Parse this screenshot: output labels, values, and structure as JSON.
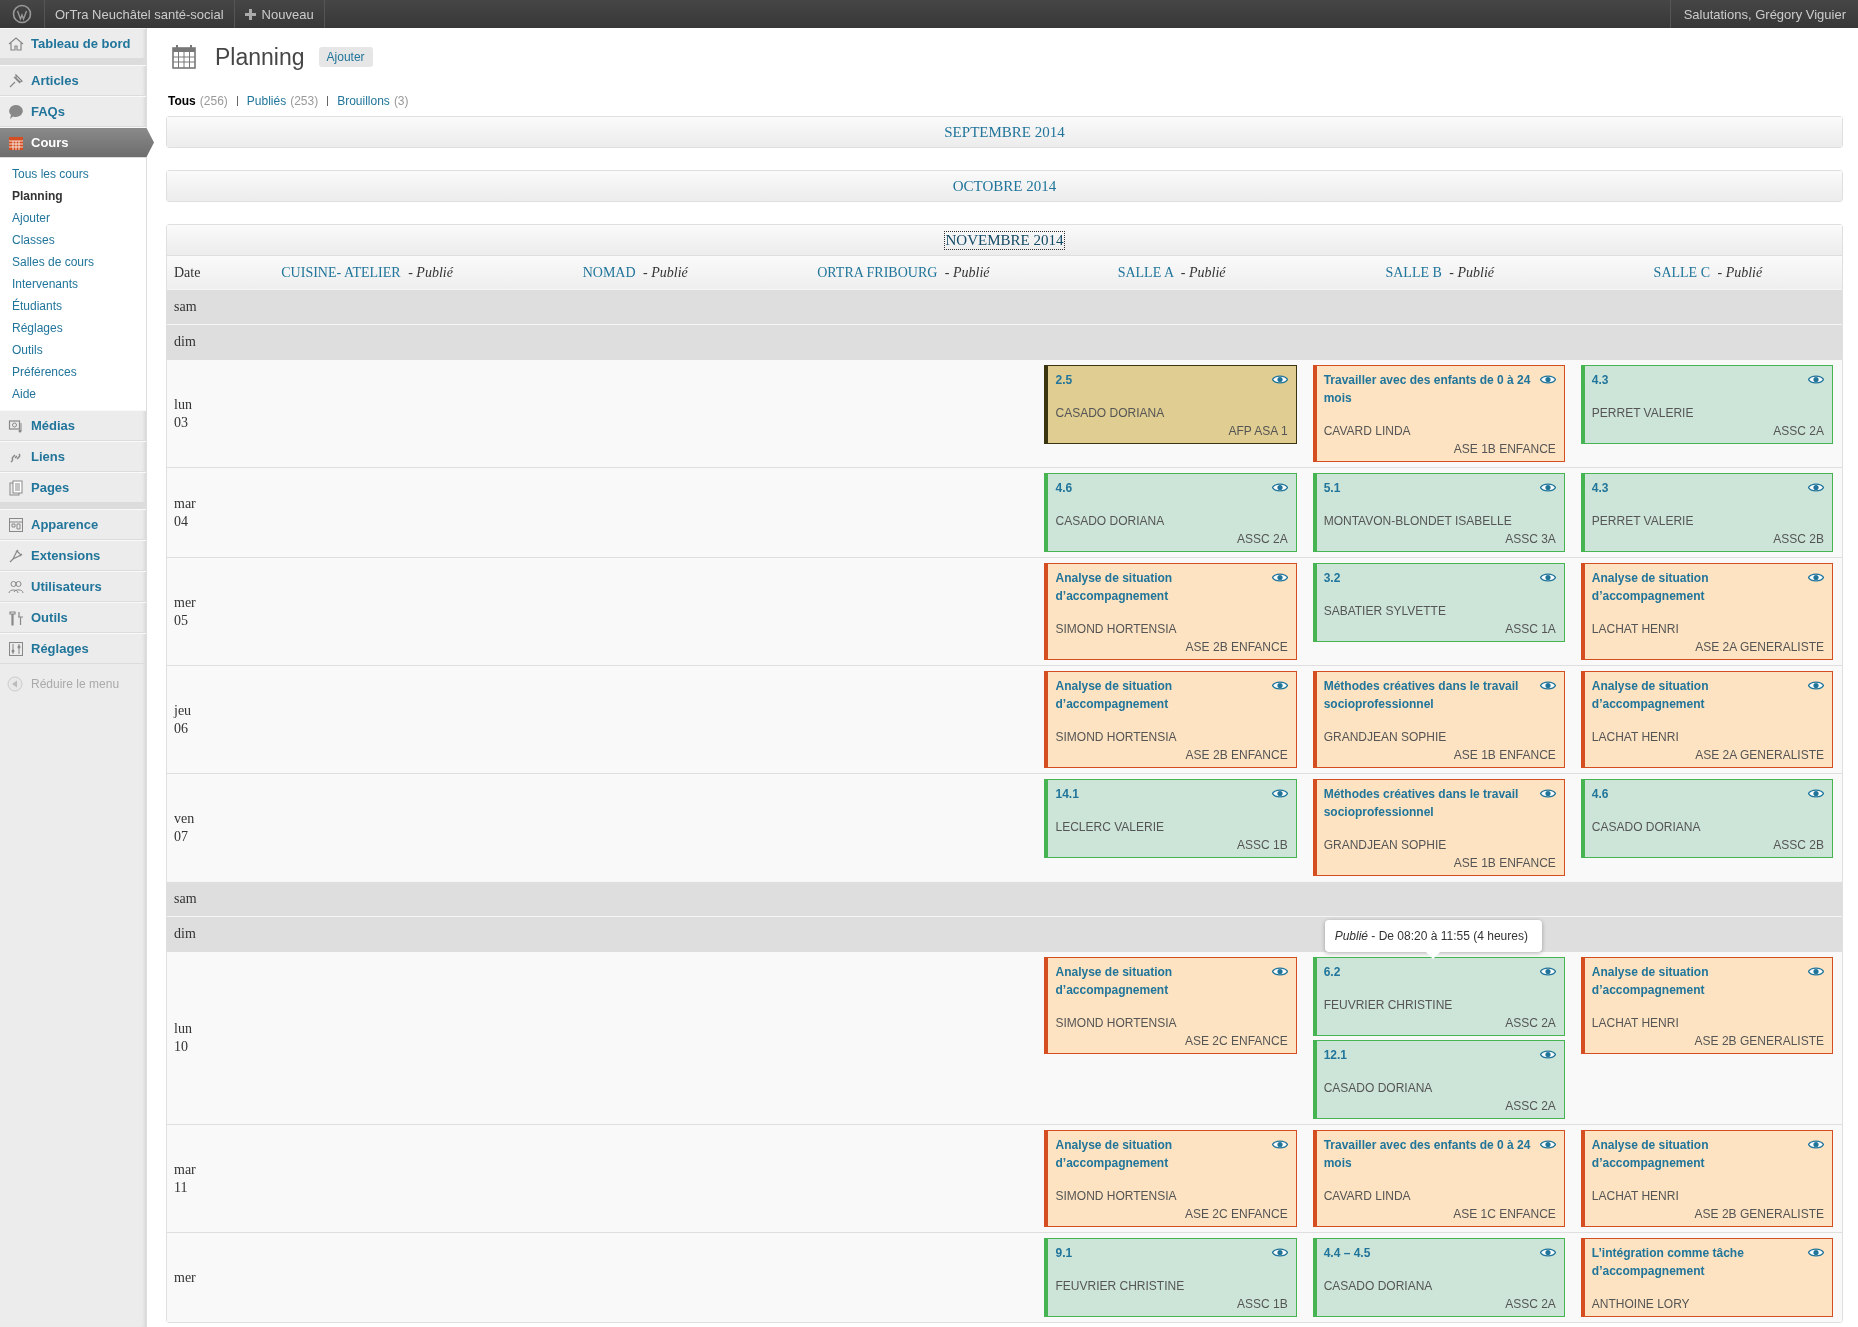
{
  "admin_bar": {
    "site_name": "OrTra Neuchâtel santé-social",
    "new_label": "Nouveau",
    "greeting": "Salutations, Grégory Viguier"
  },
  "sidebar": {
    "groups": [
      [
        {
          "label": "Tableau de bord",
          "selected": false
        }
      ],
      [
        {
          "label": "Articles",
          "selected": false
        },
        {
          "label": "FAQs",
          "selected": false
        },
        {
          "label": "Cours",
          "selected": true,
          "children": [
            {
              "label": "Tous les cours",
              "selected": false
            },
            {
              "label": "Planning",
              "selected": true
            },
            {
              "label": "Ajouter",
              "selected": false
            },
            {
              "label": "Classes",
              "selected": false
            },
            {
              "label": "Salles de cours",
              "selected": false
            },
            {
              "label": "Intervenants",
              "selected": false
            },
            {
              "label": "Étudiants",
              "selected": false
            },
            {
              "label": "Réglages",
              "selected": false
            },
            {
              "label": "Outils",
              "selected": false
            },
            {
              "label": "Préférences",
              "selected": false
            },
            {
              "label": "Aide",
              "selected": false
            }
          ]
        },
        {
          "label": "Médias",
          "selected": false
        },
        {
          "label": "Liens",
          "selected": false
        },
        {
          "label": "Pages",
          "selected": false
        }
      ],
      [
        {
          "label": "Apparence",
          "selected": false
        },
        {
          "label": "Extensions",
          "selected": false
        },
        {
          "label": "Utilisateurs",
          "selected": false
        },
        {
          "label": "Outils",
          "selected": false
        },
        {
          "label": "Réglages",
          "selected": false
        }
      ]
    ],
    "collapse_label": "Réduire le menu"
  },
  "page": {
    "title": "Planning",
    "add_button": "Ajouter"
  },
  "filters": [
    {
      "label": "Tous",
      "count": "(256)",
      "selected": true
    },
    {
      "label": "Publiés",
      "count": "(253)",
      "selected": false
    },
    {
      "label": "Brouillons",
      "count": "(3)",
      "selected": false
    }
  ],
  "months": [
    {
      "label": "SEPTEMBRE 2014",
      "expanded": false,
      "focused": false
    },
    {
      "label": "OCTOBRE 2014",
      "expanded": false,
      "focused": false
    },
    {
      "label": "NOVEMBRE 2014",
      "expanded": true,
      "focused": true
    }
  ],
  "table": {
    "date_header": "Date",
    "columns": [
      {
        "name": "CUISINE- ATELIER",
        "status": "- *Publié*"
      },
      {
        "name": "NOMAD",
        "status": "- *Publié*"
      },
      {
        "name": "ORTRA FRIBOURG",
        "status": "- *Publié*"
      },
      {
        "name": "SALLE A",
        "status": "- *Publié*"
      },
      {
        "name": "SALLE B",
        "status": "- *Publié*"
      },
      {
        "name": "SALLE C",
        "status": "- *Publié*"
      }
    ],
    "rows": [
      {
        "kind": "weekend",
        "day": "sam"
      },
      {
        "kind": "weekend",
        "day": "dim"
      },
      {
        "kind": "day",
        "day": "lun",
        "number": "03",
        "cells": [
          {},
          {},
          {},
          {
            "events": [
              {
                "title": "2.5",
                "teacher": "CASADO DORIANA",
                "class": "AFP ASA 1",
                "color": "#dfcd91"
              }
            ]
          },
          {
            "events": [
              {
                "title": "Travailler avec des enfants de 0 à 24 mois",
                "teacher": "CAVARD LINDA",
                "class": "ASE 1B ENFANCE",
                "color": "#fde3c1"
              }
            ]
          },
          {
            "events": [
              {
                "title": "4.3",
                "teacher": "PERRET VALERIE",
                "class": "ASSC 2A",
                "color": "#cde5d9"
              }
            ]
          }
        ]
      },
      {
        "kind": "day",
        "day": "mar",
        "number": "04",
        "cells": [
          {},
          {},
          {},
          {
            "events": [
              {
                "title": "4.6",
                "teacher": "CASADO DORIANA",
                "class": "ASSC 2A",
                "color": "#cde5d9"
              }
            ]
          },
          {
            "events": [
              {
                "title": "5.1",
                "teacher": "MONTAVON-BLONDET ISABELLE",
                "class": "ASSC 3A",
                "color": "#cde5d9"
              }
            ]
          },
          {
            "events": [
              {
                "title": "4.3",
                "teacher": "PERRET VALERIE",
                "class": "ASSC 2B",
                "color": "#cde5d9"
              }
            ]
          }
        ]
      },
      {
        "kind": "day",
        "day": "mer",
        "number": "05",
        "cells": [
          {},
          {},
          {},
          {
            "events": [
              {
                "title": "Analyse de situation d’accompagnement",
                "teacher": "SIMOND HORTENSIA",
                "class": "ASE 2B ENFANCE",
                "color": "#fde3c1"
              }
            ]
          },
          {
            "events": [
              {
                "title": "3.2",
                "teacher": "SABATIER SYLVETTE",
                "class": "ASSC 1A",
                "color": "#cde5d9"
              }
            ]
          },
          {
            "events": [
              {
                "title": "Analyse de situation d’accompagnement",
                "teacher": "LACHAT HENRI",
                "class": "ASE 2A GENERALISTE",
                "color": "#fde3c1"
              }
            ]
          }
        ]
      },
      {
        "kind": "day",
        "day": "jeu",
        "number": "06",
        "cells": [
          {},
          {},
          {},
          {
            "events": [
              {
                "title": "Analyse de situation d’accompagnement",
                "teacher": "SIMOND HORTENSIA",
                "class": "ASE 2B ENFANCE",
                "color": "#fde3c1"
              }
            ]
          },
          {
            "events": [
              {
                "title": "Méthodes créatives dans le travail socioprofessionnel",
                "teacher": "GRANDJEAN SOPHIE",
                "class": "ASE 1B ENFANCE",
                "color": "#fde3c1"
              }
            ]
          },
          {
            "events": [
              {
                "title": "Analyse de situation d’accompagnement",
                "teacher": "LACHAT HENRI",
                "class": "ASE 2A GENERALISTE",
                "color": "#fde3c1"
              }
            ]
          }
        ]
      },
      {
        "kind": "day",
        "day": "ven",
        "number": "07",
        "cells": [
          {},
          {},
          {},
          {
            "events": [
              {
                "title": "14.1",
                "teacher": "LECLERC VALERIE",
                "class": "ASSC 1B",
                "color": "#cde5d9"
              }
            ]
          },
          {
            "events": [
              {
                "title": "Méthodes créatives dans le travail socioprofessionnel",
                "teacher": "GRANDJEAN SOPHIE",
                "class": "ASE 1B ENFANCE",
                "color": "#fde3c1"
              }
            ]
          },
          {
            "events": [
              {
                "title": "4.6",
                "teacher": "CASADO DORIANA",
                "class": "ASSC 2B",
                "color": "#cde5d9"
              }
            ]
          }
        ]
      },
      {
        "kind": "weekend",
        "day": "sam"
      },
      {
        "kind": "weekend",
        "day": "dim"
      },
      {
        "kind": "day",
        "day": "lun",
        "number": "10",
        "cells": [
          {},
          {},
          {},
          {
            "events": [
              {
                "title": "Analyse de situation d’accompagnement",
                "teacher": "SIMOND HORTENSIA",
                "class": "ASE 2C ENFANCE",
                "color": "#fde3c1"
              }
            ]
          },
          {
            "events": [
              {
                "title": "6.2",
                "teacher": "FEUVRIER CHRISTINE",
                "class": "ASSC 2A",
                "color": "#cde5d9",
                "tooltip": "*Publié* - De 08:20 à 11:55 (4 heures)"
              },
              {
                "title": "12.1",
                "teacher": "CASADO DORIANA",
                "class": "ASSC 2A",
                "color": "#cde5d9"
              }
            ]
          },
          {
            "events": [
              {
                "title": "Analyse de situation d’accompagnement",
                "teacher": "LACHAT HENRI",
                "class": "ASE 2B GENERALISTE",
                "color": "#fde3c1"
              }
            ]
          }
        ]
      },
      {
        "kind": "day",
        "day": "mar",
        "number": "11",
        "cells": [
          {},
          {},
          {},
          {
            "events": [
              {
                "title": "Analyse de situation d’accompagnement",
                "teacher": "SIMOND HORTENSIA",
                "class": "ASE 2C ENFANCE",
                "color": "#fde3c1"
              }
            ]
          },
          {
            "events": [
              {
                "title": "Travailler avec des enfants de 0 à 24 mois",
                "teacher": "CAVARD LINDA",
                "class": "ASE 1C ENFANCE",
                "color": "#fde3c1"
              }
            ]
          },
          {
            "events": [
              {
                "title": "Analyse de situation d’accompagnement",
                "teacher": "LACHAT HENRI",
                "class": "ASE 2B GENERALISTE",
                "color": "#fde3c1"
              }
            ]
          }
        ]
      },
      {
        "kind": "day",
        "day": "mer",
        "cells": [
          {},
          {},
          {},
          {
            "events": [
              {
                "title": "9.1",
                "teacher": "FEUVRIER CHRISTINE",
                "class": "ASSC 1B",
                "color": "#cde5d9"
              }
            ]
          },
          {
            "events": [
              {
                "title": "4.4 – 4.5",
                "teacher": "CASADO DORIANA",
                "class": "ASSC 2A",
                "color": "#cde5d9"
              }
            ]
          },
          {
            "events": [
              {
                "title": "L’intégration comme tâche d’accompagnement",
                "teacher": "ANTHOINE LORY",
                "color": "#fde3c1"
              }
            ]
          }
        ]
      }
    ]
  }
}
